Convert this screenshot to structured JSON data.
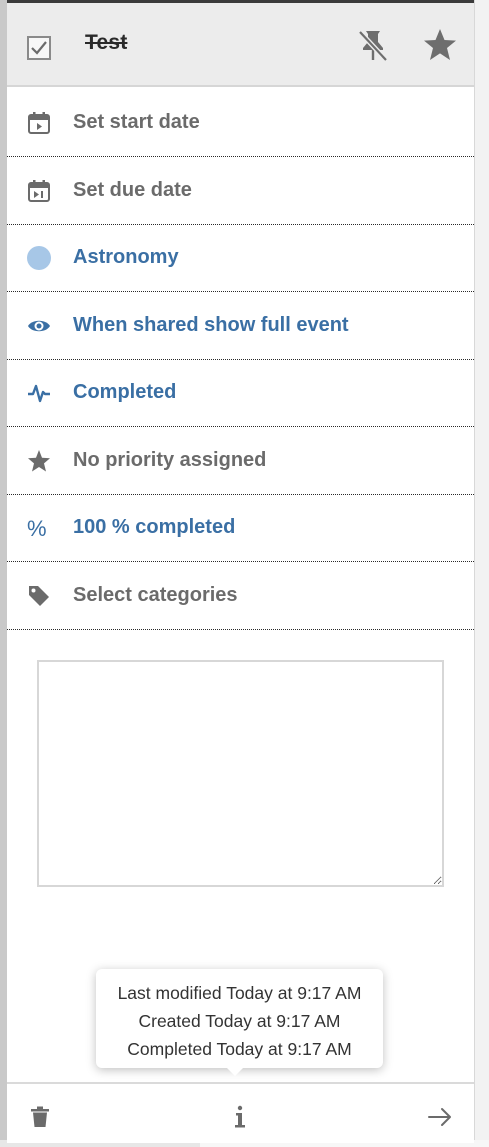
{
  "header": {
    "title": "Test",
    "checkbox_checked": true,
    "icons": [
      "checkbox-icon",
      "unpin-icon",
      "star-icon"
    ]
  },
  "rows": [
    {
      "icon": "calendar-start-icon",
      "label": "Set start date",
      "color": "#6b6b6b"
    },
    {
      "icon": "calendar-due-icon",
      "label": "Set due date",
      "color": "#6b6b6b"
    },
    {
      "icon": "circle-icon",
      "label": "Astronomy",
      "color": "#3a6fa4",
      "swatch": "#a7c7e7"
    },
    {
      "icon": "eye-icon",
      "label": "When shared show full event",
      "color": "#3a6fa4"
    },
    {
      "icon": "activity-icon",
      "label": "Completed",
      "color": "#3a6fa4"
    },
    {
      "icon": "star-icon",
      "label": "No priority assigned",
      "color": "#6b6b6b"
    },
    {
      "icon": "percent-icon",
      "label": "100 % completed",
      "color": "#3a6fa4"
    },
    {
      "icon": "tag-icon",
      "label": "Select categories",
      "color": "#6b6b6b"
    }
  ],
  "notes": {
    "value": ""
  },
  "tooltip": {
    "line1": "Last modified Today at 9:17 AM",
    "line2": "Created Today at 9:17 AM",
    "line3": "Completed Today at 9:17 AM"
  },
  "footer": {
    "icons": [
      "trash-icon",
      "info-icon",
      "arrow-right-icon"
    ]
  }
}
